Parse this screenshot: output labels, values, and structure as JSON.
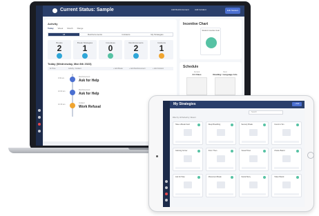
{
  "laptop": {
    "app": {
      "title": "Current Status: Sample",
      "toolbar_actions": [
        "Add Reinforcement",
        "Add Incident"
      ],
      "primary_button": "Edit Student"
    },
    "activity": {
      "title": "Activity",
      "subtabs": [
        "Today",
        "Week",
        "Month",
        "Range"
      ],
      "active_subtab": "Today",
      "segments": [
        "All",
        "Reinforcements",
        "Incidents",
        "My Strategies"
      ],
      "active_segment": "All",
      "stats": [
        {
          "label": "Breaks",
          "value": "2",
          "color": "#2fa6d8"
        },
        {
          "label": "Break Strategies",
          "value": "1",
          "color": "#2fa6d8"
        },
        {
          "label": "Incentives",
          "value": "0",
          "color": "#56c2a4"
        },
        {
          "label": "Reinforcements",
          "value": "2",
          "color": "#2fa6d8"
        },
        {
          "label": "Incidents",
          "value": "1",
          "color": "#f0a531"
        }
      ],
      "timeline_heading": "Today (Wednesday, Mar 8th 2023)",
      "timeline_columns": [
        "At Time",
        "Activity / Incident",
        "+ Add Break",
        "+ Add Reinforcement",
        "+ Add Incident"
      ],
      "timeline": [
        {
          "time": "9:30 am",
          "kind": "Reinforcement",
          "label": "Ask for Help",
          "color": "#4a6fd1"
        },
        {
          "time": "10:00 am",
          "kind": "Reinforcement",
          "label": "Ask for Help",
          "color": "#4a6fd1"
        },
        {
          "time": "10:30 am",
          "kind": "Incident",
          "label": "Work Refusal",
          "color": "#f0a531"
        }
      ]
    },
    "incentive_chart": {
      "title": "Incentive Chart",
      "tile_label": "Student Incentive Goal"
    },
    "schedule": {
      "title": "Schedule",
      "columns": [
        {
          "head": "Current",
          "item": "Art Class"
        },
        {
          "head": "Next",
          "item": "Reading / Language Arts"
        }
      ]
    },
    "footer": "Copyright © Hero, all rights reserved"
  },
  "tablet": {
    "title": "My Strategies",
    "button": "+ Add",
    "search_placeholder": "Search",
    "filter_label": "Filter by: All Sorted by: Recent",
    "cards": [
      {
        "title": "Take a Break Card"
      },
      {
        "title": "Deep Breathing"
      },
      {
        "title": "Sensory Break"
      },
      {
        "title": "Count to Ten"
      },
      {
        "title": "Calming Corner"
      },
      {
        "title": "First / Then"
      },
      {
        "title": "Visual Timer"
      },
      {
        "title": "Choice Board"
      },
      {
        "title": "Ask for Help"
      },
      {
        "title": "Movement Break"
      },
      {
        "title": "Social Story"
      },
      {
        "title": "Token Board"
      }
    ]
  }
}
